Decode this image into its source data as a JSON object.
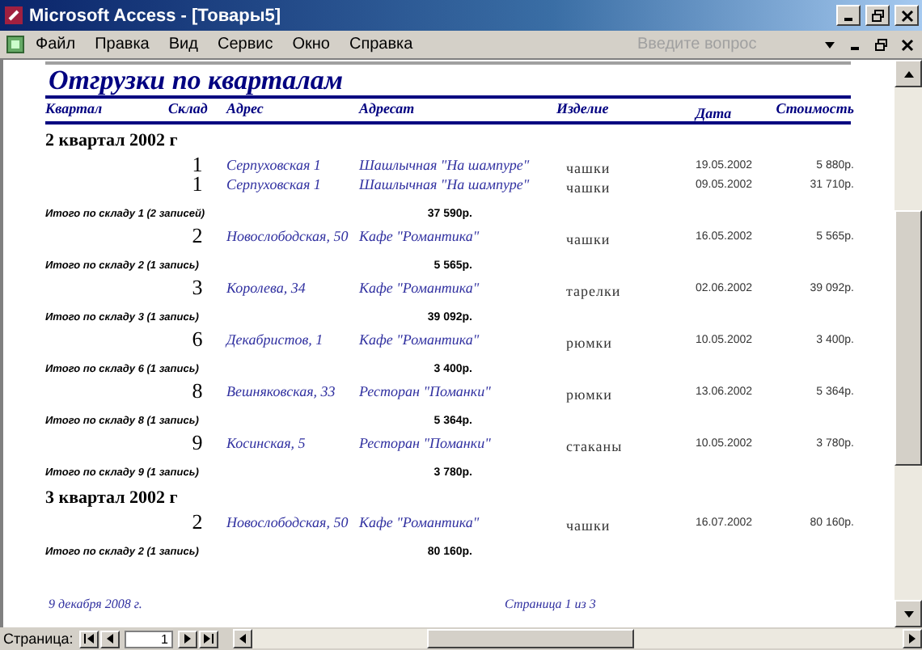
{
  "window": {
    "title": "Microsoft Access - [Товары5]"
  },
  "menu": [
    "Файл",
    "Правка",
    "Вид",
    "Сервис",
    "Окно",
    "Справка"
  ],
  "help_search": {
    "placeholder": "Введите вопрос"
  },
  "report": {
    "title": "Отгрузки по кварталам",
    "columns": [
      "Квартал",
      "Склад",
      "Адрес",
      "Адресат",
      "Изделие",
      "Дата",
      "Стоимость"
    ],
    "quarters": [
      {
        "label": "2 квартал 2002 г",
        "stores": [
          {
            "rows": [
              {
                "store": "1",
                "address": "Серпуховская 1",
                "recipient": "Шашлычная \"На шампуре\"",
                "product": "чашки",
                "date": "19.05.2002",
                "cost": "5 880р."
              },
              {
                "store": "1",
                "address": "Серпуховская 1",
                "recipient": "Шашлычная \"На шампуре\"",
                "product": "чашки",
                "date": "09.05.2002",
                "cost": "31 710р."
              }
            ],
            "total_label": "Итого по складу 1 (2 записей)",
            "total": "37 590р."
          },
          {
            "rows": [
              {
                "store": "2",
                "address": "Новослободская, 50",
                "recipient": "Кафе \"Романтика\"",
                "product": "чашки",
                "date": "16.05.2002",
                "cost": "5 565р."
              }
            ],
            "total_label": "Итого по складу 2 (1 запись)",
            "total": "5 565р."
          },
          {
            "rows": [
              {
                "store": "3",
                "address": "Королева, 34",
                "recipient": "Кафе \"Романтика\"",
                "product": "тарелки",
                "date": "02.06.2002",
                "cost": "39 092р."
              }
            ],
            "total_label": "Итого по складу 3 (1 запись)",
            "total": "39 092р."
          },
          {
            "rows": [
              {
                "store": "6",
                "address": "Декабристов, 1",
                "recipient": "Кафе \"Романтика\"",
                "product": "рюмки",
                "date": "10.05.2002",
                "cost": "3 400р."
              }
            ],
            "total_label": "Итого по складу 6 (1 запись)",
            "total": "3 400р."
          },
          {
            "rows": [
              {
                "store": "8",
                "address": "Вешняковская, 33",
                "recipient": "Ресторан \"Поманки\"",
                "product": "рюмки",
                "date": "13.06.2002",
                "cost": "5 364р."
              }
            ],
            "total_label": "Итого по складу 8 (1 запись)",
            "total": "5 364р."
          },
          {
            "rows": [
              {
                "store": "9",
                "address": "Косинская, 5",
                "recipient": "Ресторан \"Поманки\"",
                "product": "стаканы",
                "date": "10.05.2002",
                "cost": "3 780р."
              }
            ],
            "total_label": "Итого по складу 9 (1 запись)",
            "total": "3 780р."
          }
        ]
      },
      {
        "label": "3 квартал 2002 г",
        "stores": [
          {
            "rows": [
              {
                "store": "2",
                "address": "Новослободская, 50",
                "recipient": "Кафе \"Романтика\"",
                "product": "чашки",
                "date": "16.07.2002",
                "cost": "80 160р."
              }
            ],
            "total_label": "Итого по складу 2 (1 запись)",
            "total": "80 160р."
          }
        ]
      }
    ],
    "footer_date": "9 декабря 2008 г.",
    "footer_page": "Страница 1 из 3"
  },
  "navigator": {
    "label": "Страница:",
    "page": "1"
  }
}
